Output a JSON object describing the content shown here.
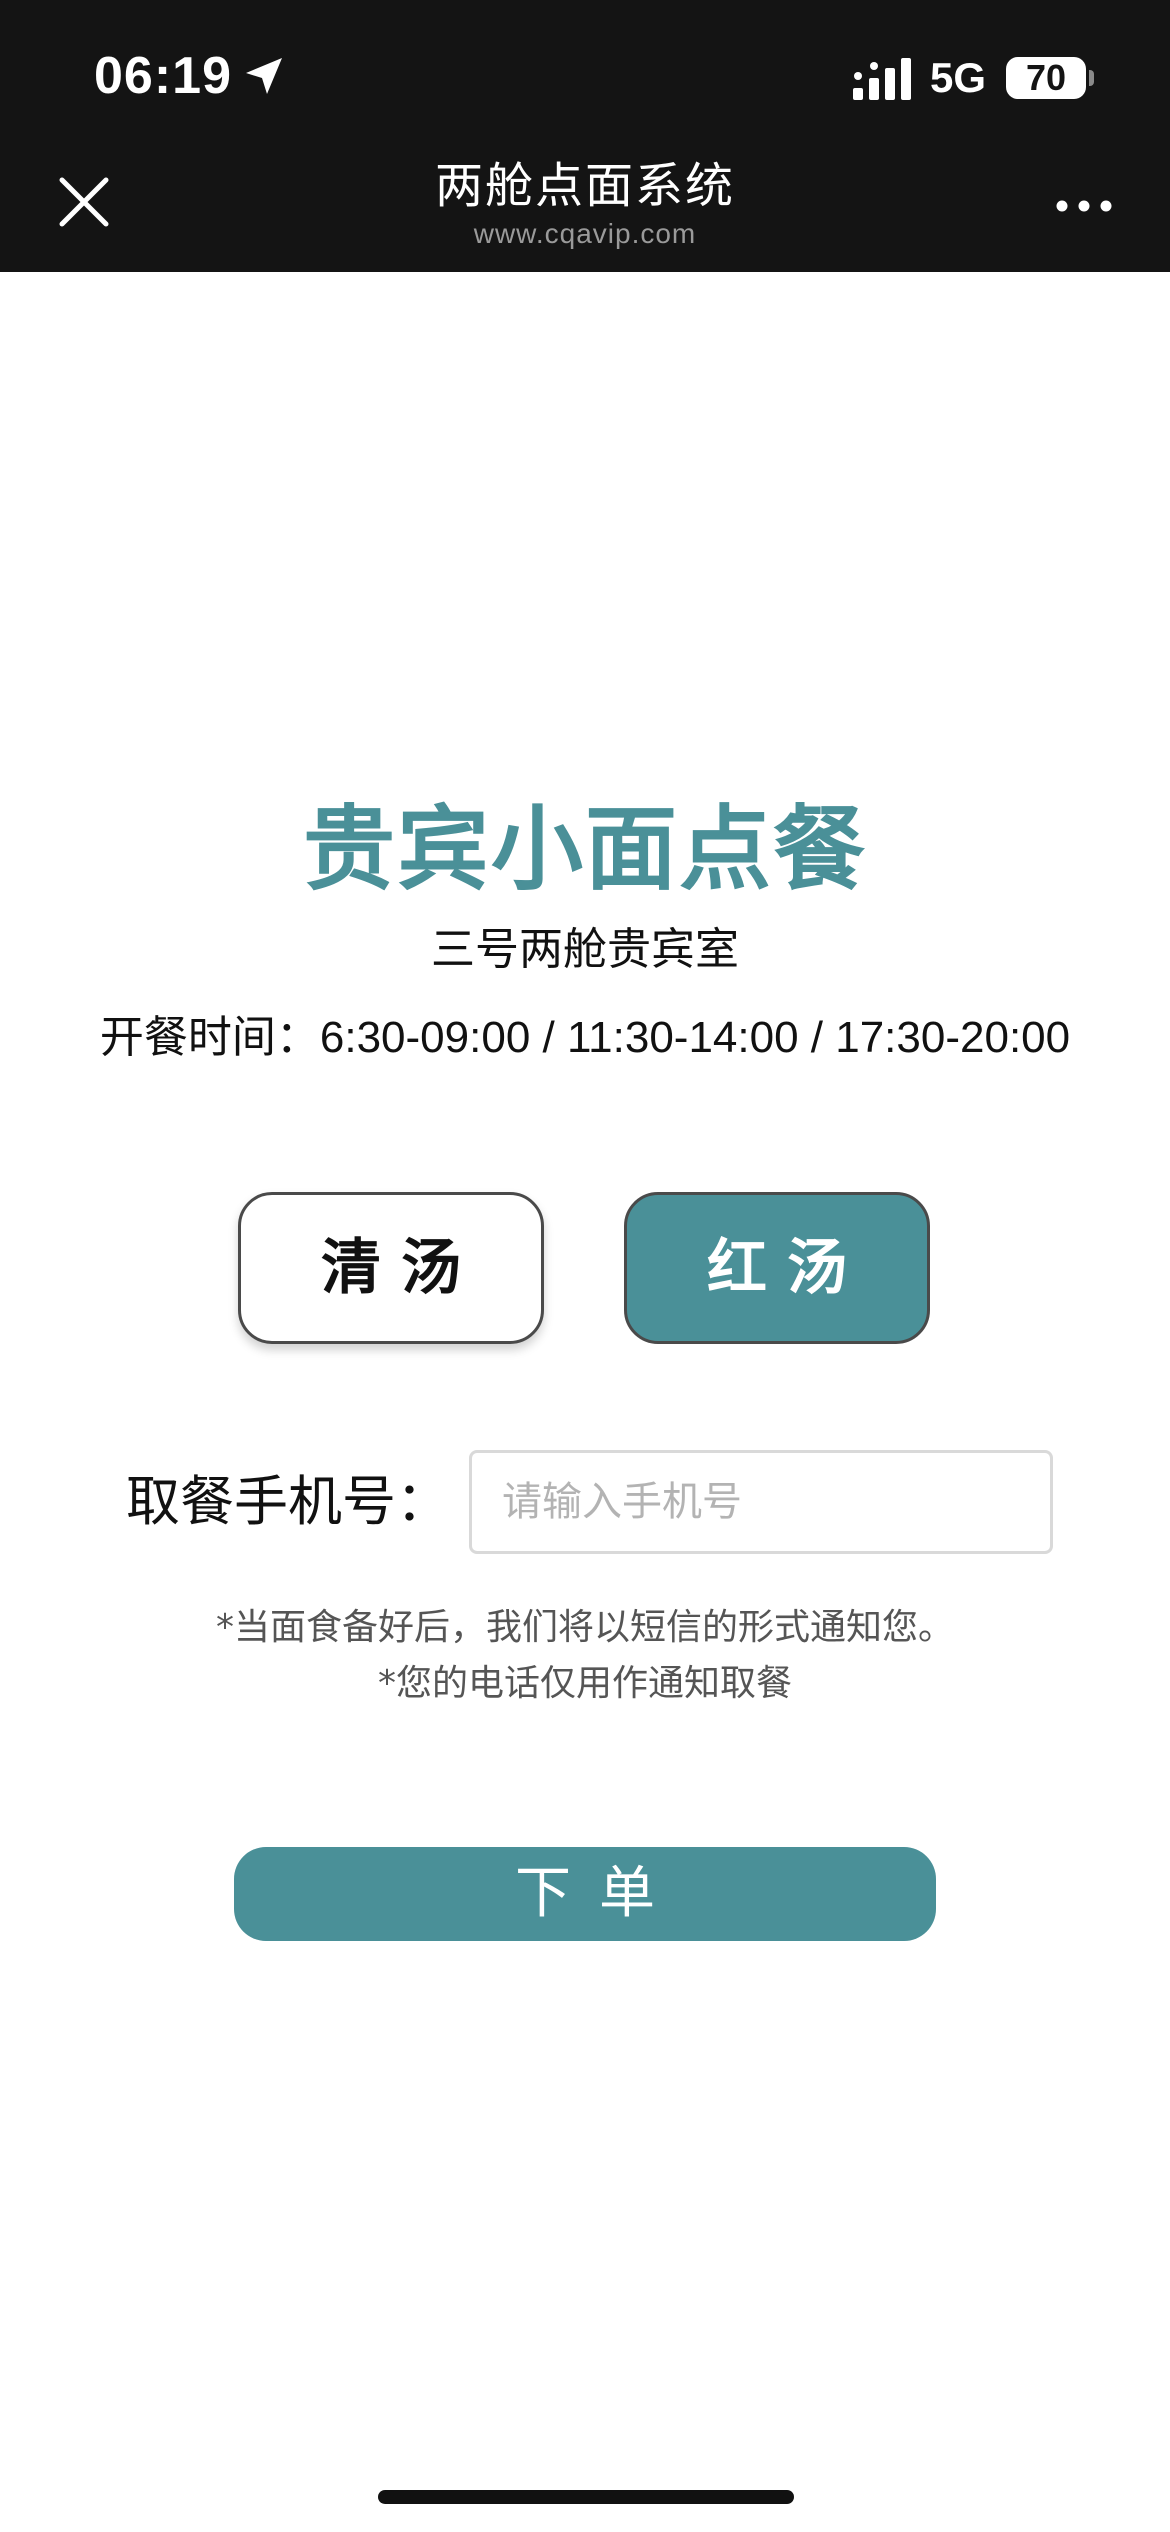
{
  "status_bar": {
    "time": "06:19",
    "network": "5G",
    "battery": "70",
    "icons": [
      "location-arrow-icon",
      "cellular-signal-icon",
      "battery-icon"
    ]
  },
  "nav": {
    "title": "两舱点面系统",
    "url": "www.cqavip.com",
    "icons": [
      "close-icon",
      "more-icon"
    ]
  },
  "main": {
    "headline": "贵宾小面点餐",
    "subtitle": "三号两舱贵宾室",
    "hours_label": "开餐时间：",
    "hours_value": "6:30-09:00 / 11:30-14:00 / 17:30-20:00",
    "soup_options": [
      {
        "label": "清汤",
        "selected": false
      },
      {
        "label": "红汤",
        "selected": true
      }
    ],
    "phone_label": "取餐手机号：",
    "phone_placeholder": "请输入手机号",
    "phone_value": "",
    "notes": [
      "*当面食备好后，我们将以短信的形式通知您。",
      "*您的电话仅用作通知取餐"
    ],
    "submit_label": "下单"
  },
  "colors": {
    "accent": "#4a9098",
    "topbar_bg": "#141414",
    "text": "#111111",
    "note_text": "#555555",
    "placeholder": "#b3b3b3"
  }
}
